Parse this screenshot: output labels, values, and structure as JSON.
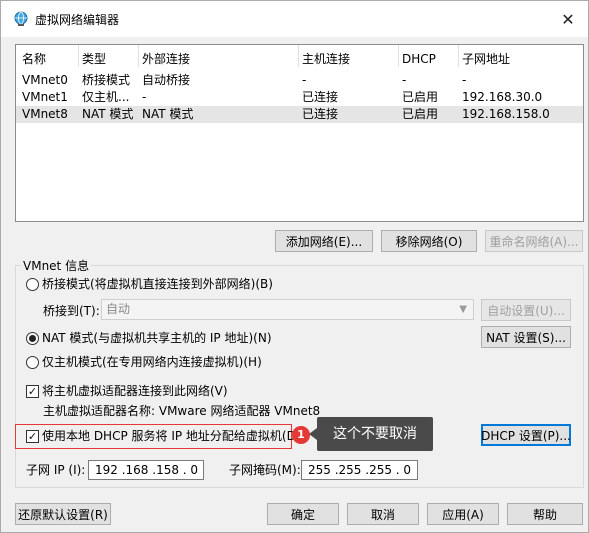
{
  "window": {
    "title": "虚拟网络编辑器",
    "close_glyph": "✕"
  },
  "table": {
    "columns": [
      "名称",
      "类型",
      "外部连接",
      "主机连接",
      "DHCP",
      "子网地址"
    ],
    "rows": [
      [
        "VMnet0",
        "桥接模式",
        "自动桥接",
        "-",
        "-",
        "-"
      ],
      [
        "VMnet1",
        "仅主机...",
        "-",
        "已连接",
        "已启用",
        "192.168.30.0"
      ],
      [
        "VMnet8",
        "NAT 模式",
        "NAT 模式",
        "已连接",
        "已启用",
        "192.168.158.0"
      ]
    ],
    "selected_row": 2
  },
  "table_buttons": {
    "add": "添加网络(E)...",
    "remove": "移除网络(O)",
    "rename": "重命名网络(A)..."
  },
  "vmnet_info": {
    "label": "VMnet 信息",
    "bridge_radio": "桥接模式(将虚拟机直接连接到外部网络)(B)",
    "bridge_to_label": "桥接到(T):",
    "bridge_to_value": "自动",
    "auto_settings": "自动设置(U)...",
    "nat_radio": "NAT 模式(与虚拟机共享主机的 IP 地址)(N)",
    "nat_settings": "NAT 设置(S)...",
    "host_only_radio": "仅主机模式(在专用网络内连接虚拟机)(H)",
    "selected_mode": "nat",
    "connect_adapter": "将主机虚拟适配器连接到此网络(V)",
    "adapter_name": "主机虚拟适配器名称: VMware 网络适配器 VMnet8",
    "use_dhcp": "使用本地 DHCP 服务将 IP 地址分配给虚拟机(D)",
    "dhcp_settings": "DHCP 设置(P)...",
    "subnet_ip_label": "子网 IP (I):",
    "subnet_ip": "192 .168 .158 .  0",
    "subnet_mask_label": "子网掩码(M):",
    "subnet_mask": "255 .255 .255 .  0"
  },
  "annotation": {
    "badge": "1",
    "tooltip": "这个不要取消",
    "color": "#e53935"
  },
  "footer": {
    "restore": "还原默认设置(R)",
    "ok": "确定",
    "cancel": "取消",
    "apply": "应用(A)",
    "help": "帮助"
  },
  "colors": {
    "selected_row": "#e5e5e5",
    "focus": "#0078d7",
    "tooltip_bg": "#4a4a4a"
  }
}
